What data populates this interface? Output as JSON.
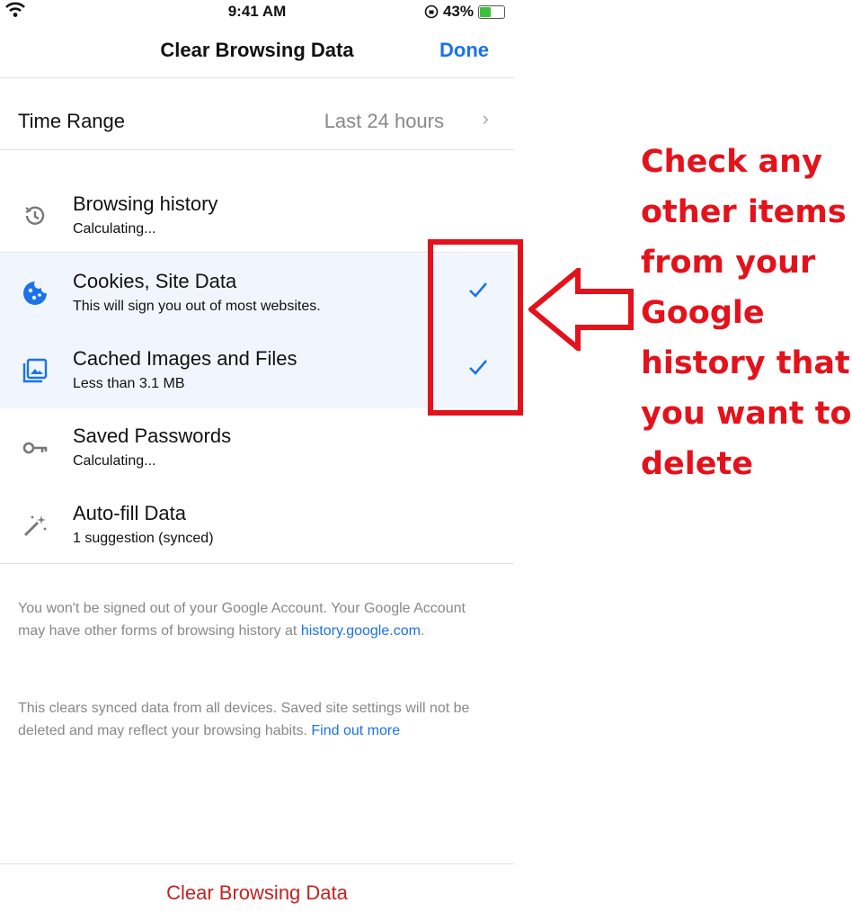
{
  "status_bar": {
    "time": "9:41 AM",
    "battery": "43%"
  },
  "nav": {
    "title": "Clear Browsing Data",
    "done_label": "Done"
  },
  "time_range": {
    "label": "Time Range",
    "value": "Last 24 hours"
  },
  "items": [
    {
      "title": "Browsing history",
      "subtitle": "Calculating...",
      "checked": false,
      "icon": "history-icon"
    },
    {
      "title": "Cookies, Site Data",
      "subtitle": "This will sign you out of most websites.",
      "checked": true,
      "icon": "cookie-icon"
    },
    {
      "title": "Cached Images and Files",
      "subtitle": "Less than 3.1 MB",
      "checked": true,
      "icon": "image-icon"
    },
    {
      "title": "Saved Passwords",
      "subtitle": "Calculating...",
      "checked": false,
      "icon": "key-icon"
    },
    {
      "title": "Auto-fill Data",
      "subtitle": "1 suggestion (synced)",
      "checked": false,
      "icon": "magic-wand-icon"
    }
  ],
  "footer": {
    "account_note": "You won't be signed out of your Google Account. Your Google Account may have other forms of browsing history at",
    "history_link": "history.google.com",
    "account_note_end": ".",
    "sync_note": "This clears synced data from all devices. Saved site settings will not be deleted and may reflect your browsing habits.",
    "find_out_more": "Find out more"
  },
  "clear_button": "Clear Browsing Data",
  "annotation": {
    "lines": [
      "Check any",
      "other items",
      "from your",
      "Google",
      "history that",
      "you want to",
      "delete"
    ],
    "color": "#e4121b"
  },
  "colors": {
    "accent": "#1a73e8",
    "destructive": "#c5221f",
    "selected_row": "#f1f5fd"
  }
}
